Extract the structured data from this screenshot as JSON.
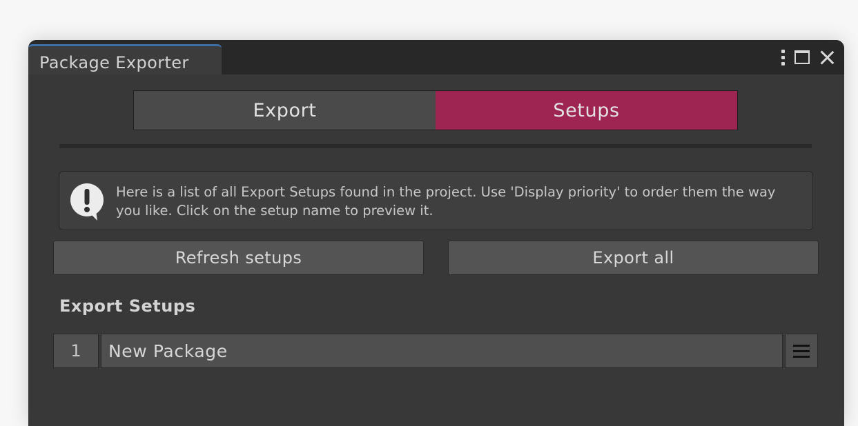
{
  "window": {
    "title": "Package Exporter",
    "tab_accent": "#3d6fa6",
    "controls": {
      "menu_icon": "kebab-menu-icon",
      "maximize_icon": "maximize-icon",
      "close_icon": "close-icon"
    }
  },
  "mode_toggle": {
    "export_label": "Export",
    "setups_label": "Setups",
    "active": "Setups",
    "active_color": "#9e2452"
  },
  "help": {
    "icon": "exclamation-speech-bubble-icon",
    "text": "Here is a list of all Export Setups found in the project. Use 'Display priority' to order them the way you like. Click on the setup name to preview it."
  },
  "actions": {
    "refresh_label": "Refresh setups",
    "export_all_label": "Export all"
  },
  "section": {
    "title": "Export Setups"
  },
  "setups": [
    {
      "index": "1",
      "name": "New Package",
      "menu_icon": "hamburger-menu-icon"
    }
  ]
}
